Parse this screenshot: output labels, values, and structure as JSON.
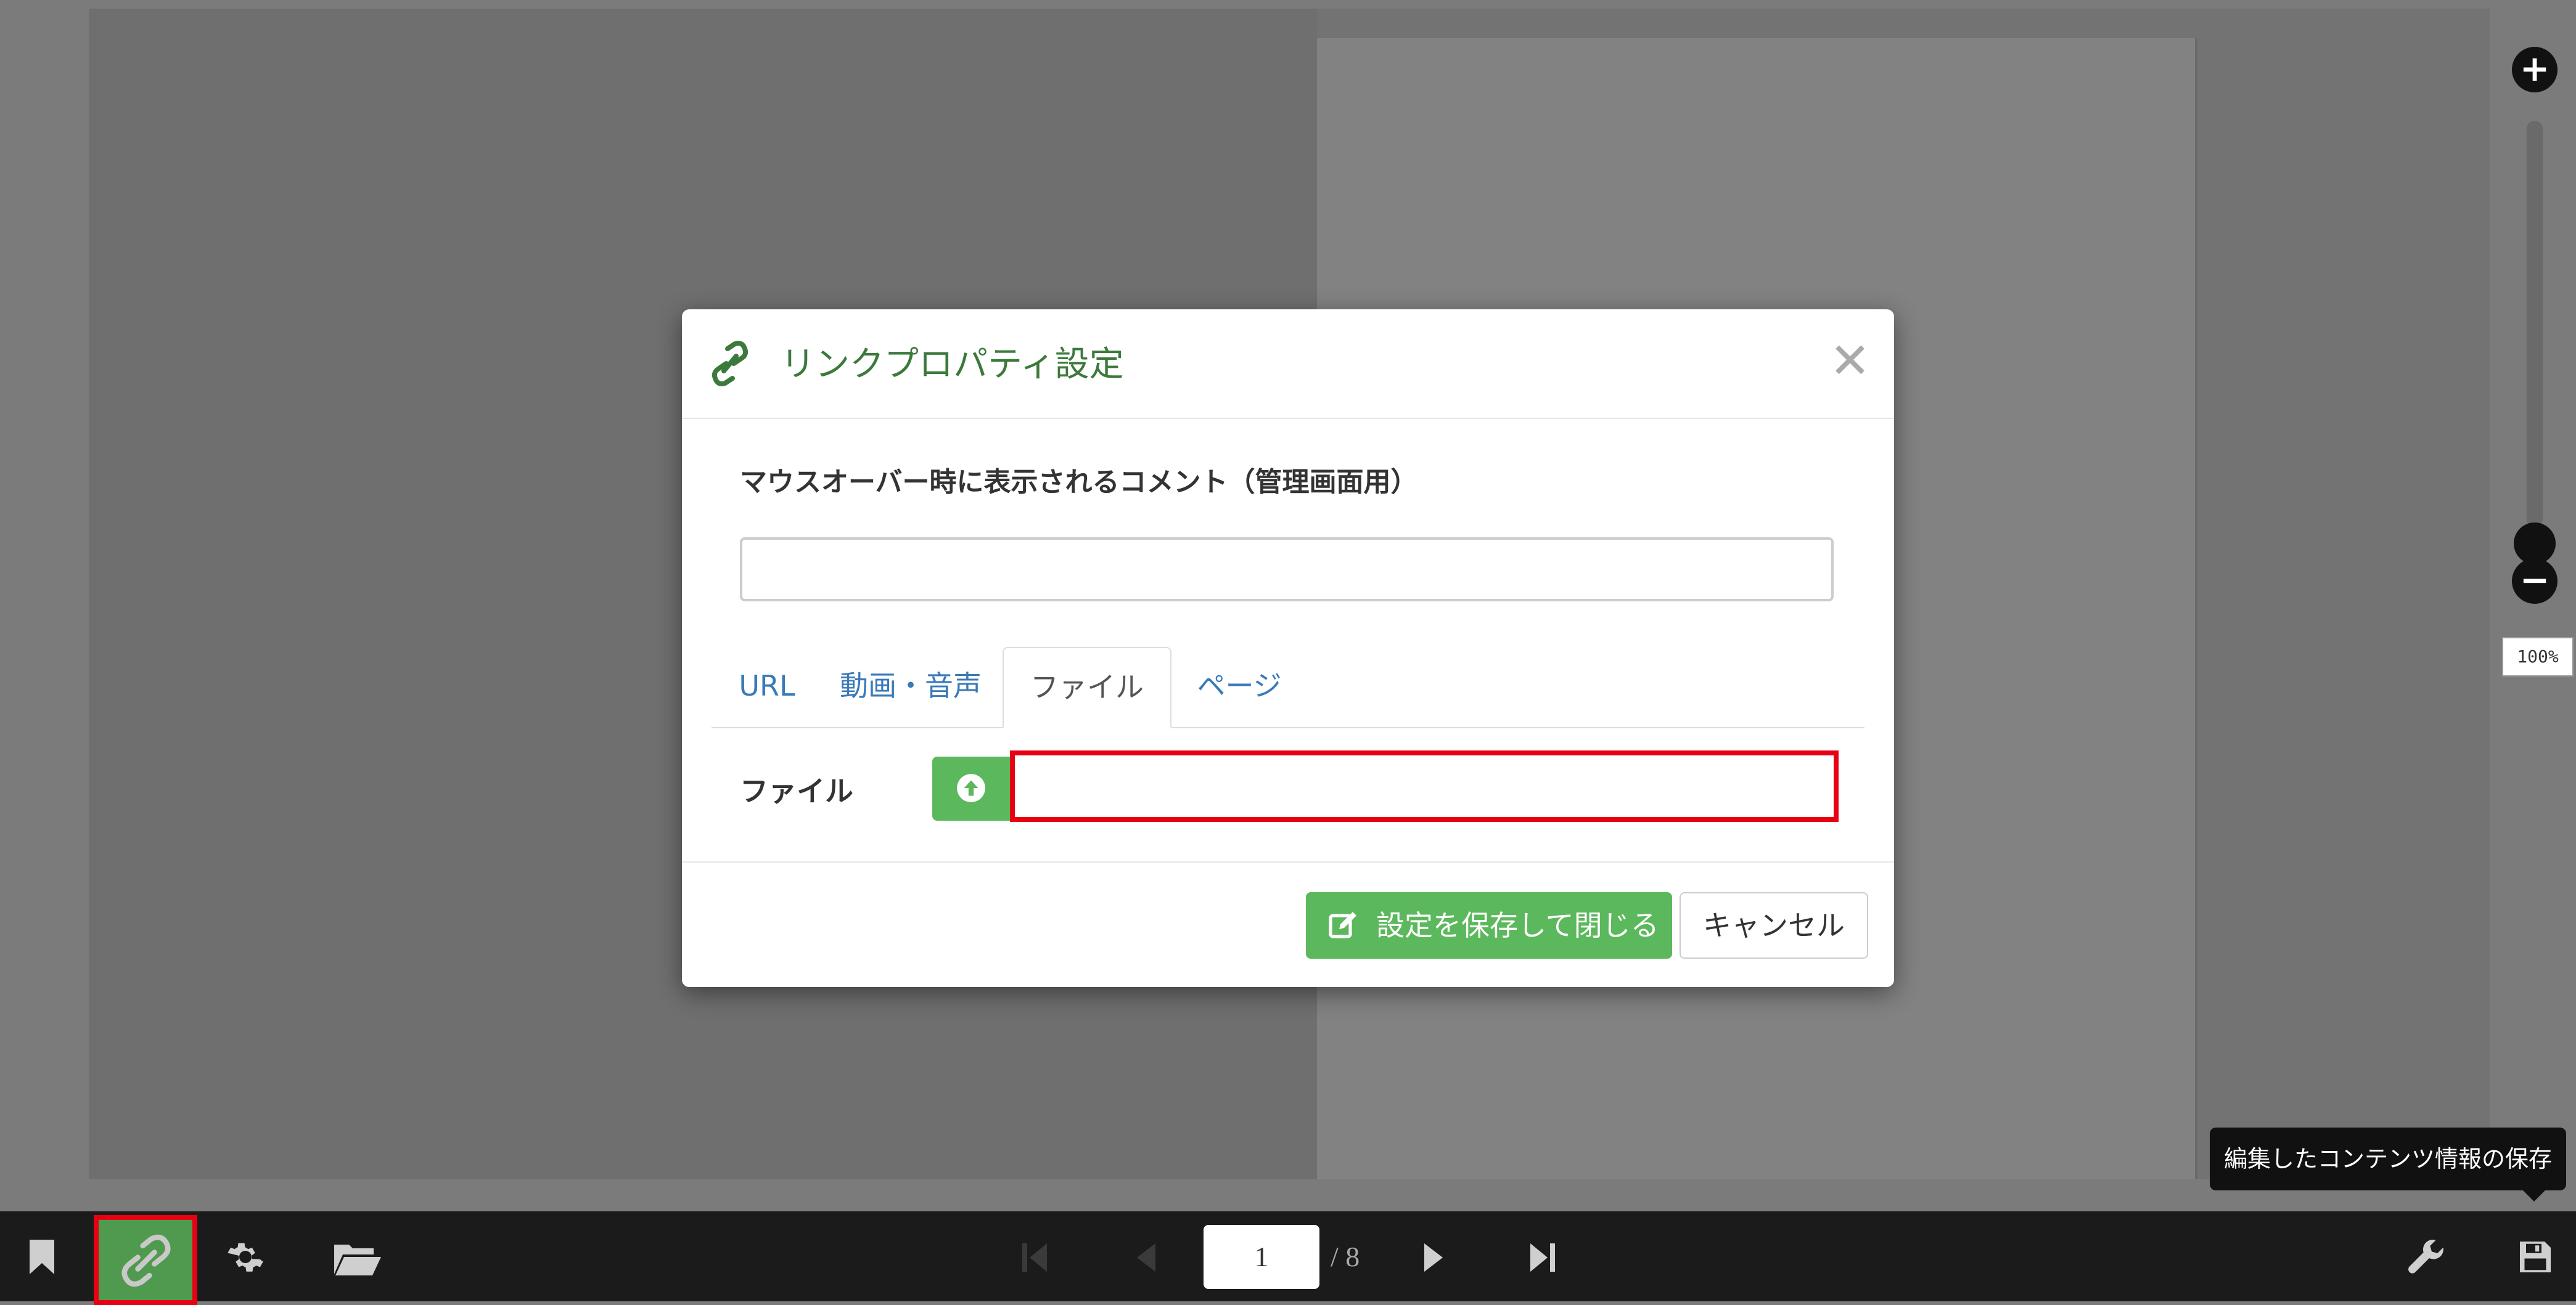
{
  "modal": {
    "title": "リンクプロパティ設定",
    "close_glyph": "✕",
    "comment_label": "マウスオーバー時に表示されるコメント（管理画面用）",
    "comment_value": "",
    "tabs": [
      {
        "label": "URL",
        "active": false
      },
      {
        "label": "動画・音声",
        "active": false
      },
      {
        "label": "ファイル",
        "active": true
      },
      {
        "label": "ページ",
        "active": false
      }
    ],
    "file_label": "ファイル",
    "file_value": "",
    "save_label": "設定を保存して閉じる",
    "cancel_label": "キャンセル"
  },
  "zoom": {
    "plus": "+",
    "minus": "−",
    "level_label": "100%"
  },
  "tooltip": {
    "text": "編集したコンテンツ情報の保存"
  },
  "toolbar": {
    "current_page": "1",
    "total_pages": "/ 8",
    "icons": [
      "bookmark-icon",
      "link-icon",
      "gear-icon",
      "folder-open-icon",
      "first-page-icon",
      "prev-page-icon",
      "next-page-icon",
      "last-page-icon",
      "wrench-icon",
      "save-icon"
    ]
  },
  "colors": {
    "accent_green": "#5cb85c",
    "title_green": "#3c7a3c",
    "highlight_red": "#e60012",
    "tab_link_blue": "#3a7ab8"
  }
}
